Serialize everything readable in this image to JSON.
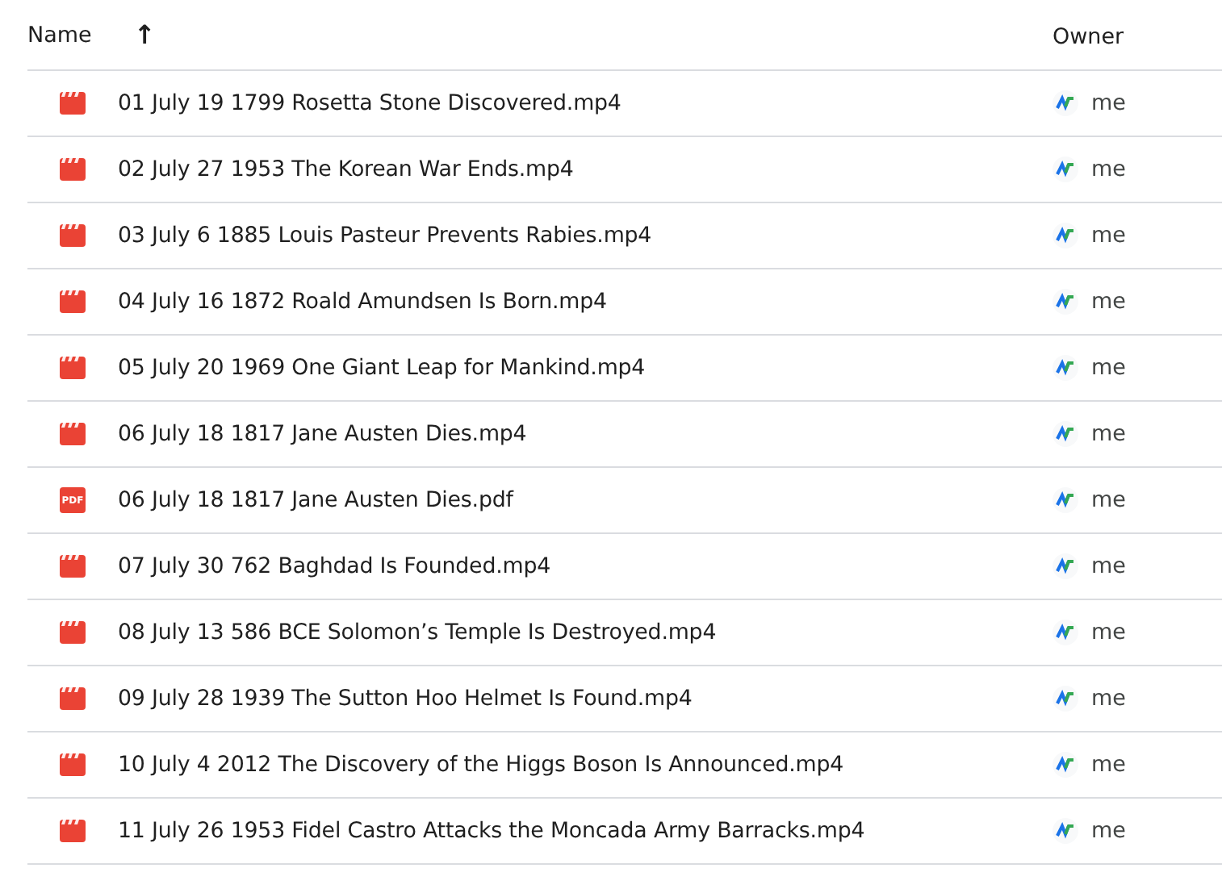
{
  "columns": [
    {
      "label": "Name",
      "sort_icon": "↑"
    },
    {
      "label": "Owner"
    }
  ],
  "files": [
    {
      "kind": "video",
      "name": "01 July 19 1799 Rosetta Stone Discovered.mp4",
      "owner": "me"
    },
    {
      "kind": "video",
      "name": "02 July 27 1953 The Korean War Ends.mp4",
      "owner": "me"
    },
    {
      "kind": "video",
      "name": "03 July 6 1885 Louis Pasteur Prevents Rabies.mp4",
      "owner": "me"
    },
    {
      "kind": "video",
      "name": "04 July 16 1872 Roald Amundsen Is Born.mp4",
      "owner": "me"
    },
    {
      "kind": "video",
      "name": "05 July 20 1969 One Giant Leap for Mankind.mp4",
      "owner": "me"
    },
    {
      "kind": "video",
      "name": "06 July 18 1817 Jane Austen Dies.mp4",
      "owner": "me"
    },
    {
      "kind": "pdf",
      "badge": "PDF",
      "name": "06 July 18 1817 Jane Austen Dies.pdf",
      "owner": "me"
    },
    {
      "kind": "video",
      "name": "07 July 30 762 Baghdad Is Founded.mp4",
      "owner": "me"
    },
    {
      "kind": "video",
      "name": "08 July 13 586 BCE Solomon’s Temple Is Destroyed.mp4",
      "owner": "me"
    },
    {
      "kind": "video",
      "name": "09 July 28 1939 The Sutton Hoo Helmet Is Found.mp4",
      "owner": "me"
    },
    {
      "kind": "video",
      "name": "10 July 4 2012 The Discovery of the Higgs Boson Is Announced.mp4",
      "owner": "me"
    },
    {
      "kind": "video",
      "name": "11 July 26 1953 Fidel Castro Attacks the Moncada Army Barracks.mp4",
      "owner": "me"
    }
  ]
}
